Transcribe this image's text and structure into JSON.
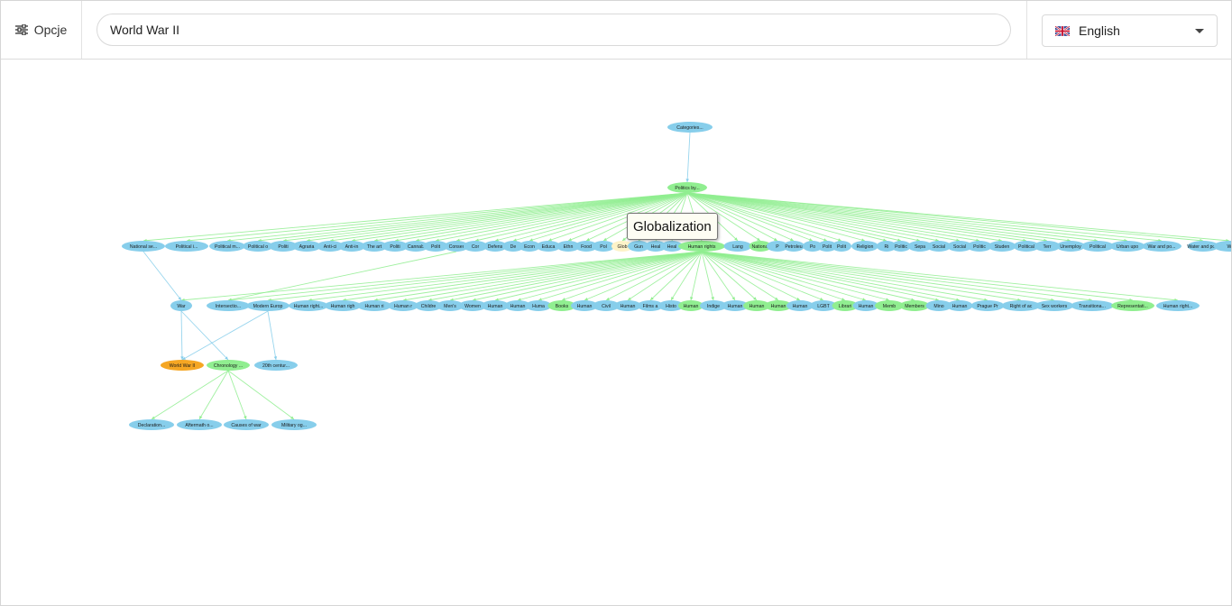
{
  "toolbar": {
    "options_label": "Opcje"
  },
  "search": {
    "value": "World War II"
  },
  "language": {
    "selected": "English"
  },
  "tooltip": {
    "text": "Globalization"
  },
  "colors": {
    "node_default": "#87ceeb",
    "node_highlight": "#90ee90",
    "node_selected": "#f5a623",
    "node_hover": "#fdf3c8",
    "edge_blue": "#87ceeb",
    "edge_green": "#90ee90"
  },
  "graph": {
    "nodes": [
      {
        "id": "categories",
        "label": "Categories...",
        "level": 0,
        "color": "default"
      },
      {
        "id": "politicsby",
        "label": "Politics by...",
        "level": 1,
        "color": "highlight"
      },
      {
        "id": "national-se",
        "label": "National se...",
        "level": 2,
        "color": "default"
      },
      {
        "id": "political-i",
        "label": "Political i...",
        "level": 2,
        "color": "default"
      },
      {
        "id": "political-m",
        "label": "Political m...",
        "level": 2,
        "color": "default"
      },
      {
        "id": "political-o",
        "label": "Political o",
        "level": 2,
        "color": "default"
      },
      {
        "id": "politi-1",
        "label": "Politi",
        "level": 2,
        "color": "default"
      },
      {
        "id": "agrarian",
        "label": "Agraria",
        "level": 2,
        "color": "default"
      },
      {
        "id": "anti-c",
        "label": "Anti-ci",
        "level": 2,
        "color": "default"
      },
      {
        "id": "anti-in",
        "label": "Anti-in",
        "level": 2,
        "color": "default"
      },
      {
        "id": "the-art",
        "label": "The art",
        "level": 2,
        "color": "default"
      },
      {
        "id": "politi-2",
        "label": "Politi",
        "level": 2,
        "color": "default"
      },
      {
        "id": "cannab",
        "label": "Cannab",
        "level": 2,
        "color": "default"
      },
      {
        "id": "polit-3",
        "label": "Polit",
        "level": 2,
        "color": "default"
      },
      {
        "id": "conser",
        "label": "Conser",
        "level": 2,
        "color": "default"
      },
      {
        "id": "cor",
        "label": "Cor",
        "level": 2,
        "color": "default"
      },
      {
        "id": "defens",
        "label": "Defens",
        "level": 2,
        "color": "default"
      },
      {
        "id": "de",
        "label": "De",
        "level": 2,
        "color": "default"
      },
      {
        "id": "econ",
        "label": "Econ",
        "level": 2,
        "color": "default"
      },
      {
        "id": "educa",
        "label": "Educa",
        "level": 2,
        "color": "default"
      },
      {
        "id": "ethn",
        "label": "Ethn",
        "level": 2,
        "color": "default"
      },
      {
        "id": "food",
        "label": "Food",
        "level": 2,
        "color": "default"
      },
      {
        "id": "pol-4",
        "label": "Pol",
        "level": 2,
        "color": "default"
      },
      {
        "id": "globalization",
        "label": "Glob",
        "level": 2,
        "color": "hover"
      },
      {
        "id": "gun",
        "label": "Gun",
        "level": 2,
        "color": "default"
      },
      {
        "id": "heal-1",
        "label": "Heal",
        "level": 2,
        "color": "default"
      },
      {
        "id": "heal-2",
        "label": "Heal",
        "level": 2,
        "color": "default"
      },
      {
        "id": "human-rights",
        "label": "Human rights",
        "level": 2,
        "color": "highlight"
      },
      {
        "id": "lang",
        "label": "Lang",
        "level": 2,
        "color": "default"
      },
      {
        "id": "national",
        "label": "National",
        "level": 2,
        "color": "highlight"
      },
      {
        "id": "p-5",
        "label": "P",
        "level": 2,
        "color": "default"
      },
      {
        "id": "petroleu",
        "label": "Petroleu",
        "level": 2,
        "color": "default"
      },
      {
        "id": "po-6",
        "label": "Po",
        "level": 2,
        "color": "default"
      },
      {
        "id": "polit-7",
        "label": "Polit",
        "level": 2,
        "color": "default"
      },
      {
        "id": "polit-8",
        "label": "Polit",
        "level": 2,
        "color": "default"
      },
      {
        "id": "religion",
        "label": "Religion",
        "level": 2,
        "color": "default"
      },
      {
        "id": "ri",
        "label": "Ri",
        "level": 2,
        "color": "default"
      },
      {
        "id": "politic-9",
        "label": "Politic",
        "level": 2,
        "color": "default"
      },
      {
        "id": "sepa",
        "label": "Sepa",
        "level": 2,
        "color": "default"
      },
      {
        "id": "social-1",
        "label": "Social",
        "level": 2,
        "color": "default"
      },
      {
        "id": "social-2",
        "label": "Social",
        "level": 2,
        "color": "default"
      },
      {
        "id": "politic-10",
        "label": "Politic",
        "level": 2,
        "color": "default"
      },
      {
        "id": "studen",
        "label": "Studen",
        "level": 2,
        "color": "default"
      },
      {
        "id": "political-11",
        "label": "Political",
        "level": 2,
        "color": "default"
      },
      {
        "id": "terr",
        "label": "Terr",
        "level": 2,
        "color": "default"
      },
      {
        "id": "unemploy",
        "label": "Unemploy",
        "level": 2,
        "color": "default"
      },
      {
        "id": "political-12",
        "label": "Political",
        "level": 2,
        "color": "default"
      },
      {
        "id": "urban-upo",
        "label": "Urban upo",
        "level": 2,
        "color": "default"
      },
      {
        "id": "war-and-po",
        "label": "War and po...",
        "level": 2,
        "color": "default"
      },
      {
        "id": "water-and-po",
        "label": "Water and po...",
        "level": 2,
        "color": "default"
      },
      {
        "id": "w-edge",
        "label": "W",
        "level": 2,
        "color": "default"
      },
      {
        "id": "war",
        "label": "War",
        "level": 3,
        "color": "default"
      },
      {
        "id": "intersection",
        "label": "Intersectio...",
        "level": 3,
        "color": "default"
      },
      {
        "id": "modern-europ",
        "label": "Modern Europ",
        "level": 3,
        "color": "default"
      },
      {
        "id": "human-right-1",
        "label": "Human right...",
        "level": 3,
        "color": "default"
      },
      {
        "id": "human-righ-2",
        "label": "Human righ",
        "level": 3,
        "color": "default"
      },
      {
        "id": "human-ri-3",
        "label": "Human ri",
        "level": 3,
        "color": "default"
      },
      {
        "id": "human-r-4",
        "label": "Human r",
        "level": 3,
        "color": "default"
      },
      {
        "id": "childre",
        "label": "Childre",
        "level": 3,
        "color": "default"
      },
      {
        "id": "mens",
        "label": "Men's",
        "level": 3,
        "color": "default"
      },
      {
        "id": "women",
        "label": "Women",
        "level": 3,
        "color": "default"
      },
      {
        "id": "human-5",
        "label": "Human",
        "level": 3,
        "color": "default"
      },
      {
        "id": "human-6",
        "label": "Human",
        "level": 3,
        "color": "default"
      },
      {
        "id": "huma-7",
        "label": "Huma",
        "level": 3,
        "color": "default"
      },
      {
        "id": "books",
        "label": "Books",
        "level": 3,
        "color": "highlight"
      },
      {
        "id": "human-8",
        "label": "Human",
        "level": 3,
        "color": "default"
      },
      {
        "id": "civil",
        "label": "Civil",
        "level": 3,
        "color": "default"
      },
      {
        "id": "human-9",
        "label": "Human",
        "level": 3,
        "color": "default"
      },
      {
        "id": "films",
        "label": "Films a",
        "level": 3,
        "color": "default"
      },
      {
        "id": "histo",
        "label": "Histo",
        "level": 3,
        "color": "default"
      },
      {
        "id": "human-10",
        "label": "Human",
        "level": 3,
        "color": "highlight"
      },
      {
        "id": "indige",
        "label": "Indige",
        "level": 3,
        "color": "default"
      },
      {
        "id": "human-11",
        "label": "Human",
        "level": 3,
        "color": "default"
      },
      {
        "id": "human-12",
        "label": "Human",
        "level": 3,
        "color": "highlight"
      },
      {
        "id": "human-13",
        "label": "Human",
        "level": 3,
        "color": "highlight"
      },
      {
        "id": "human-14",
        "label": "Human",
        "level": 3,
        "color": "default"
      },
      {
        "id": "lgbt",
        "label": "LGBT",
        "level": 3,
        "color": "default"
      },
      {
        "id": "librari",
        "label": "Librari",
        "level": 3,
        "color": "highlight"
      },
      {
        "id": "human-15",
        "label": "Human",
        "level": 3,
        "color": "default"
      },
      {
        "id": "memb",
        "label": "Memb",
        "level": 3,
        "color": "highlight"
      },
      {
        "id": "members",
        "label": "Members",
        "level": 3,
        "color": "highlight"
      },
      {
        "id": "mino",
        "label": "Mino",
        "level": 3,
        "color": "default"
      },
      {
        "id": "human-16",
        "label": "Human",
        "level": 3,
        "color": "default"
      },
      {
        "id": "prague",
        "label": "Prague Pr",
        "level": 3,
        "color": "default"
      },
      {
        "id": "right-of",
        "label": "Right of ac",
        "level": 3,
        "color": "default"
      },
      {
        "id": "sex-workers",
        "label": "Sex workers",
        "level": 3,
        "color": "default"
      },
      {
        "id": "transitiona",
        "label": "Transitiona...",
        "level": 3,
        "color": "default"
      },
      {
        "id": "representati",
        "label": "Representati...",
        "level": 3,
        "color": "highlight"
      },
      {
        "id": "human-right-17",
        "label": "Human right...",
        "level": 3,
        "color": "default"
      },
      {
        "id": "ww2",
        "label": "World War II",
        "level": 4,
        "color": "selected"
      },
      {
        "id": "chronology",
        "label": "Chronology ...",
        "level": 4,
        "color": "highlight"
      },
      {
        "id": "20th-century",
        "label": "20th centur...",
        "level": 4,
        "color": "default"
      },
      {
        "id": "declaration",
        "label": "Declaration...",
        "level": 5,
        "color": "default"
      },
      {
        "id": "aftermath",
        "label": "Aftermath o...",
        "level": 5,
        "color": "default"
      },
      {
        "id": "causes",
        "label": "Causes of war",
        "level": 5,
        "color": "default"
      },
      {
        "id": "military",
        "label": "Military og...",
        "level": 5,
        "color": "default"
      }
    ],
    "edges": [
      {
        "from": "categories",
        "to": "politicsby",
        "color": "blue"
      },
      {
        "from": "national-se",
        "to": "war",
        "color": "blue"
      },
      {
        "from": "war",
        "to": "ww2",
        "color": "blue"
      },
      {
        "from": "war",
        "to": "chronology",
        "color": "blue"
      },
      {
        "from": "modern-europ",
        "to": "ww2",
        "color": "blue"
      },
      {
        "from": "modern-europ",
        "to": "20th-century",
        "color": "blue"
      },
      {
        "from": "conser",
        "to": "intersection",
        "color": "green"
      },
      {
        "from": "chronology",
        "to": "declaration",
        "color": "green"
      },
      {
        "from": "chronology",
        "to": "aftermath",
        "color": "green"
      },
      {
        "from": "chronology",
        "to": "causes",
        "color": "green"
      },
      {
        "from": "chronology",
        "to": "military",
        "color": "green"
      }
    ],
    "fan_edges": [
      {
        "from": "politicsby",
        "to_level": 2,
        "color": "green"
      },
      {
        "from": "human-rights",
        "to_level": 3,
        "color": "green"
      }
    ]
  }
}
